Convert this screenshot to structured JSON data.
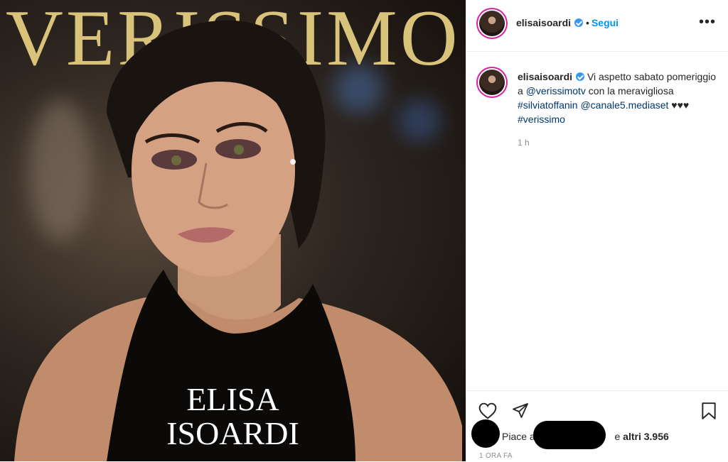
{
  "post_image": {
    "magazine_title": "VERISSIMO",
    "cover_name_line1": "ELISA",
    "cover_name_line2": "ISOARDI"
  },
  "header": {
    "username": "elisaisoardi",
    "separator": "•",
    "follow_label": "Segui",
    "more_label": "•••"
  },
  "caption": {
    "username": "elisaisoardi",
    "text_1": "Vi aspetto sabato pomeriggio a ",
    "mention_1": "@verissimotv",
    "text_2": " con la meravigliosa ",
    "hashtag_1": "#silviatoffanin",
    "mention_2": "@canale5.mediaset",
    "text_3": " ♥♥♥ ",
    "hashtag_2": "#verissimo",
    "time": "1 h"
  },
  "actions": {
    "likes_prefix": "Piace a",
    "likes_mid": "e ",
    "likes_count": "altri 3.956",
    "time_ago": "1 ORA FA"
  },
  "colors": {
    "link_blue": "#00376b",
    "follow_blue": "#0095f6",
    "verified_blue": "#3897f0",
    "gold": "#d9c27a"
  }
}
